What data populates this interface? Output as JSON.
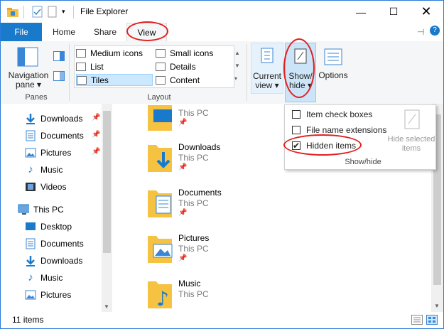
{
  "window": {
    "title": "File Explorer"
  },
  "tabs": {
    "file": "File",
    "home": "Home",
    "share": "Share",
    "view": "View"
  },
  "ribbon": {
    "panes": {
      "navigation_pane": "Navigation\npane",
      "label": "Panes"
    },
    "layout": {
      "label": "Layout",
      "items": [
        "Medium icons",
        "Small icons",
        "List",
        "Details",
        "Tiles",
        "Content"
      ],
      "selected": "Tiles"
    },
    "current_view": "Current\nview",
    "show_hide": "Show/\nhide",
    "options": "Options"
  },
  "dropdown": {
    "item_check_boxes": "Item check boxes",
    "file_name_extensions": "File name extensions",
    "hidden_items": "Hidden items",
    "hide_selected": "Hide selected\nitems",
    "label": "Show/hide",
    "checked": {
      "item_check_boxes": false,
      "file_name_extensions": false,
      "hidden_items": true
    }
  },
  "nav": {
    "quick": [
      "Downloads",
      "Documents",
      "Pictures",
      "Music",
      "Videos"
    ],
    "this_pc": "This PC",
    "pc_items": [
      "Desktop",
      "Documents",
      "Downloads",
      "Music",
      "Pictures"
    ]
  },
  "tiles": [
    {
      "name": "",
      "sub": "This PC"
    },
    {
      "name": "Downloads",
      "sub": "This PC"
    },
    {
      "name": "Documents",
      "sub": "This PC"
    },
    {
      "name": "Pictures",
      "sub": "This PC"
    },
    {
      "name": "Music",
      "sub": "This PC"
    }
  ],
  "status": {
    "count": "11 items"
  }
}
